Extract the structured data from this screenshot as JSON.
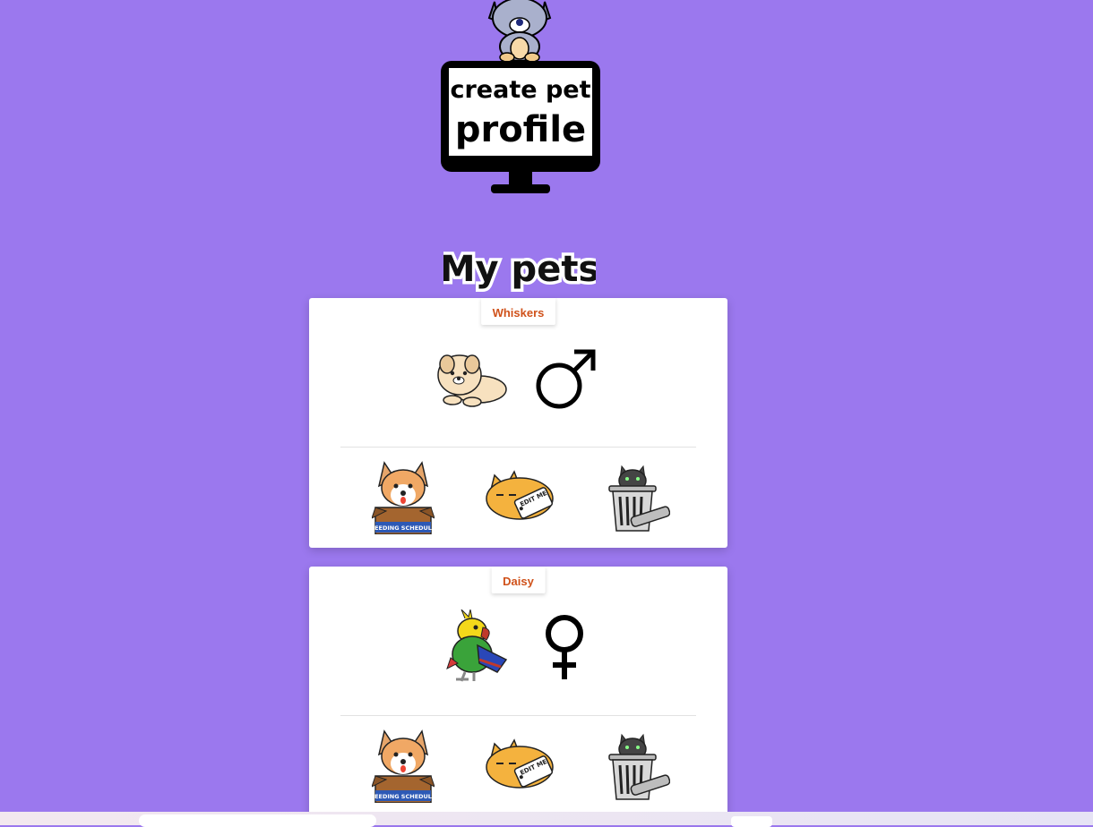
{
  "header": {
    "banner_line1": "create pet",
    "banner_line2": "profile",
    "banner_icon": "dog-on-monitor-icon"
  },
  "section_title": "My pets",
  "pets": [
    {
      "name": "Whiskers",
      "avatar": "dog-icon",
      "gender": "male"
    },
    {
      "name": "Daisy",
      "avatar": "parrot-icon",
      "gender": "female"
    }
  ],
  "actions": {
    "feeding": {
      "icon": "feeding-schedule-icon",
      "label": "FEEDING SCHEDULE"
    },
    "edit": {
      "icon": "edit-me-cat-icon",
      "label": "EDIT ME"
    },
    "delete": {
      "icon": "trash-can-cat-icon"
    }
  },
  "colors": {
    "background": "#9b78ee",
    "name_text": "#d0521b",
    "card": "#ffffff"
  }
}
